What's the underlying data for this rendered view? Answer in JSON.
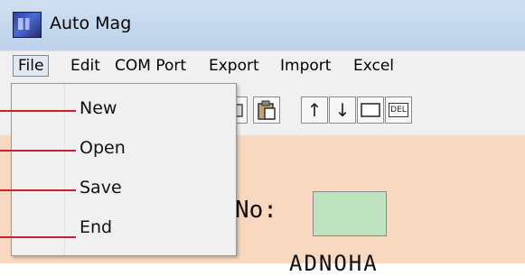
{
  "window": {
    "title": "Auto Mag"
  },
  "menubar": {
    "items": [
      "File",
      "Edit",
      "COM Port",
      "Export",
      "Import",
      "Excel"
    ]
  },
  "file_menu": {
    "items": [
      "New",
      "Open",
      "Save",
      "End"
    ]
  },
  "toolbar": {
    "up_glyph": "↑",
    "down_glyph": "↓",
    "del_label": "DEL"
  },
  "content": {
    "field_label_partial": "No:",
    "bottom_text_partial": "ADNOHA"
  }
}
